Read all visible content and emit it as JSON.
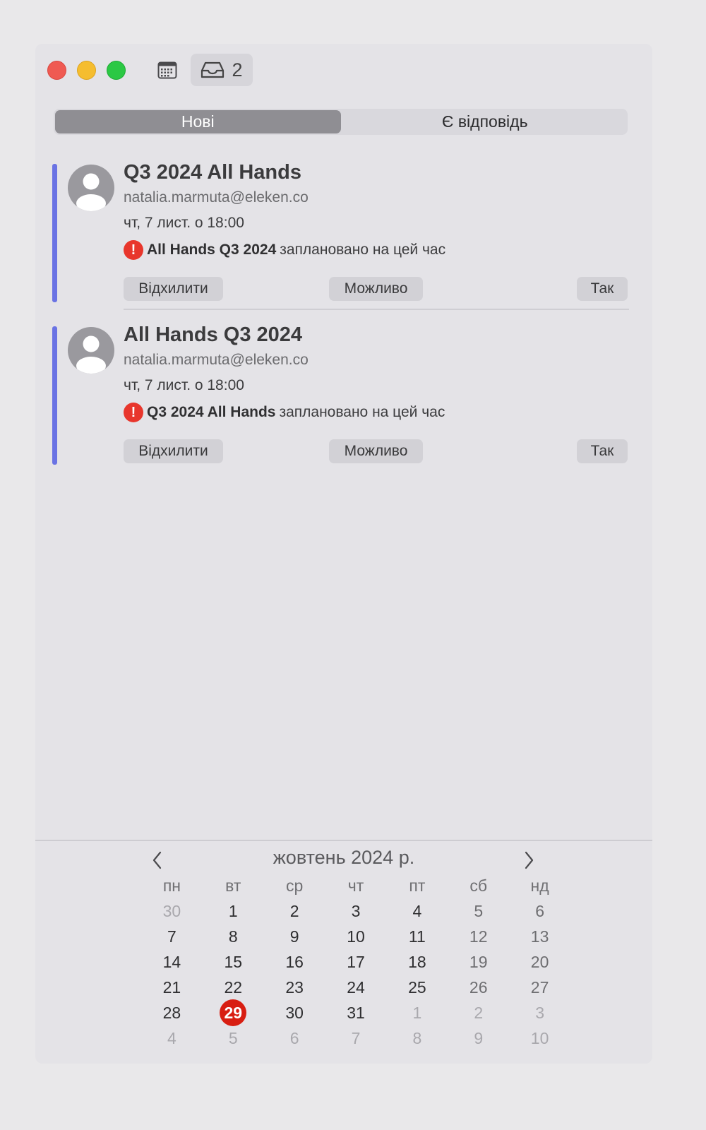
{
  "toolbar": {
    "inbox_count": "2"
  },
  "segments": {
    "new": "Нові",
    "replied": "Є відповідь"
  },
  "invitations": [
    {
      "title": "Q3 2024 All Hands",
      "email": "natalia.marmuta@eleken.co",
      "date": "чт, 7 лист. о 18:00",
      "conflict_event": "All Hands Q3 2024",
      "conflict_text": "заплановано на цей час",
      "decline": "Відхилити",
      "maybe": "Можливо",
      "accept": "Так"
    },
    {
      "title": "All Hands Q3 2024",
      "email": "natalia.marmuta@eleken.co",
      "date": "чт, 7 лист. о 18:00",
      "conflict_event": "Q3 2024 All Hands",
      "conflict_text": "заплановано на цей час",
      "decline": "Відхилити",
      "maybe": "Можливо",
      "accept": "Так"
    }
  ],
  "calendar": {
    "month_label": "жовтень 2024 р.",
    "weekdays": [
      "пн",
      "вт",
      "ср",
      "чт",
      "пт",
      "сб",
      "нд"
    ],
    "weeks": [
      [
        "30",
        "1",
        "2",
        "3",
        "4",
        "5",
        "6"
      ],
      [
        "7",
        "8",
        "9",
        "10",
        "11",
        "12",
        "13"
      ],
      [
        "14",
        "15",
        "16",
        "17",
        "18",
        "19",
        "20"
      ],
      [
        "21",
        "22",
        "23",
        "24",
        "25",
        "26",
        "27"
      ],
      [
        "28",
        "29",
        "30",
        "31",
        "1",
        "2",
        "3"
      ],
      [
        "4",
        "5",
        "6",
        "7",
        "8",
        "9",
        "10"
      ]
    ],
    "today": "29"
  },
  "colors": {
    "accent_bar": "#6a73e4",
    "today": "#d81e12",
    "warning": "#e8362c"
  }
}
